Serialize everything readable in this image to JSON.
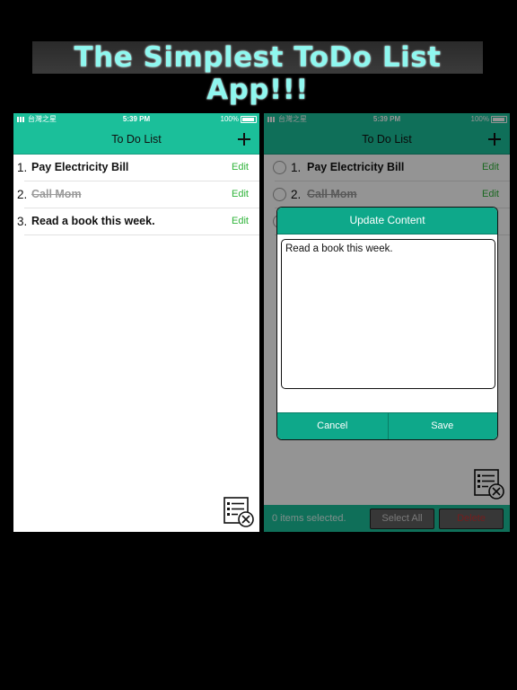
{
  "banner": {
    "title": "The Simplest ToDo List App!!!"
  },
  "status": {
    "carrier": "台灣之星",
    "time": "5:39 PM",
    "battery": "100%"
  },
  "nav": {
    "title": "To Do List"
  },
  "todos": [
    {
      "num": "1.",
      "text": "Pay Electricity Bill",
      "done": false,
      "edit_label": "Edit"
    },
    {
      "num": "2.",
      "text": "Call Mom",
      "done": true,
      "edit_label": "Edit"
    },
    {
      "num": "3.",
      "text": "Read a book this week.",
      "done": false,
      "edit_label": "Edit"
    }
  ],
  "bottom_bar": {
    "selected_text": "0 items selected.",
    "select_all_label": "Select All",
    "delete_label": "Delete"
  },
  "dialog": {
    "title": "Update Content",
    "content": "Read a book this week.",
    "cancel_label": "Cancel",
    "save_label": "Save"
  },
  "colors": {
    "accent": "#1bbf9a",
    "dialog_accent": "#0ea88a",
    "edit_green": "#2fb33a",
    "banner_text": "#8ff7ef"
  },
  "icons": {
    "add": "plus-icon",
    "clear": "list-clear-icon"
  }
}
